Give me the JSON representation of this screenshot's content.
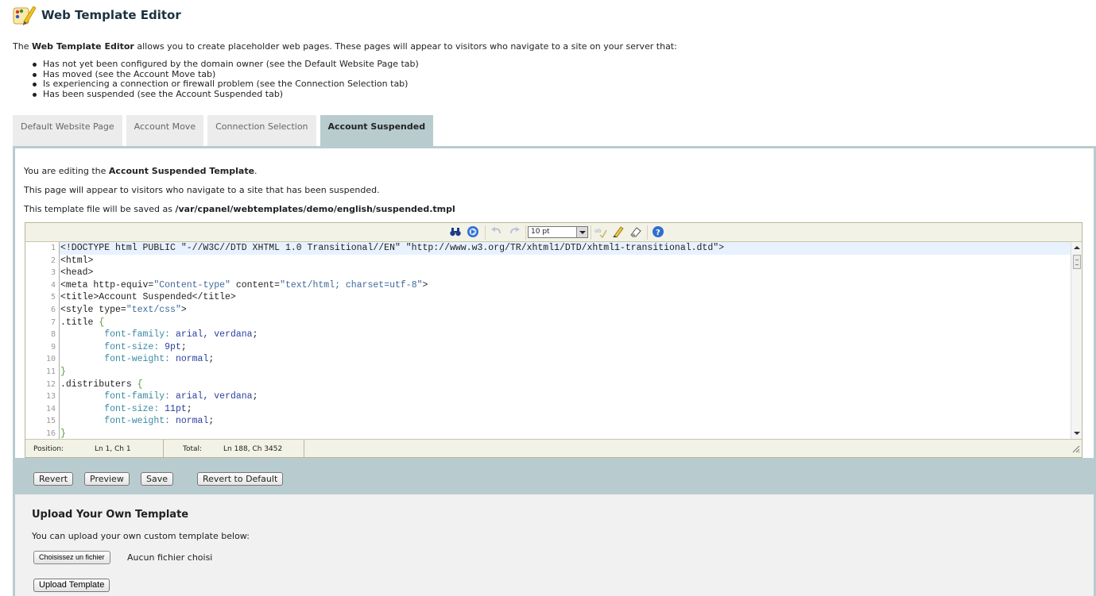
{
  "app": {
    "title": "Web Template Editor",
    "icon": "palette-brush-icon"
  },
  "intro": {
    "prefix": "The ",
    "bold": "Web Template Editor",
    "suffix": " allows you to create placeholder web pages. These pages will appear to visitors who navigate to a site on your server that:"
  },
  "bullets": [
    "Has not yet been configured by the domain owner (see the Default Website Page tab)",
    "Has moved (see the Account Move tab)",
    "Is experiencing a connection or firewall problem (see the Connection Selection tab)",
    "Has been suspended (see the Account Suspended tab)"
  ],
  "tabs": [
    {
      "label": "Default Website Page",
      "active": false
    },
    {
      "label": "Account Move",
      "active": false
    },
    {
      "label": "Connection Selection",
      "active": false
    },
    {
      "label": "Account Suspended",
      "active": true
    }
  ],
  "panel": {
    "editing_prefix": "You are editing the ",
    "editing_bold": "Account Suspended Template",
    "editing_suffix": ".",
    "description": "This page will appear to visitors who navigate to a site that has been suspended.",
    "path_prefix": "This template file will be saved as ",
    "path": "/var/cpanel/webtemplates/demo/english/suspended.tmpl"
  },
  "toolbar": {
    "font_size": "10 pt",
    "icons": [
      "search-icon",
      "goto-icon",
      "undo-icon",
      "redo-icon",
      "spellcheck-icon",
      "highlight-icon",
      "reset-icon",
      "help-icon"
    ]
  },
  "code": {
    "line_numbers": [
      "1",
      "2",
      "3",
      "4",
      "5",
      "6",
      "7",
      "8",
      "9",
      "10",
      "11",
      "12",
      "13",
      "14",
      "15",
      "16"
    ],
    "lines": [
      "<!DOCTYPE html PUBLIC \"-//W3C//DTD XHTML 1.0 Transitional//EN\" \"http://www.w3.org/TR/xhtml1/DTD/xhtml1-transitional.dtd\">",
      "<html>",
      "<head>",
      "<meta http-equiv=\"Content-type\" content=\"text/html; charset=utf-8\">",
      "<title>Account Suspended</title>",
      "<style type=\"text/css\">",
      ".title {",
      "        font-family: arial, verdana;",
      "        font-size: 9pt;",
      "        font-weight: normal;",
      "}",
      ".distributers {",
      "        font-family: arial, verdana;",
      "        font-size: 11pt;",
      "        font-weight: normal;",
      "}"
    ]
  },
  "statusbar": {
    "position_label": "Position:",
    "position_value": "Ln 1, Ch 1",
    "total_label": "Total:",
    "total_value": "Ln 188, Ch 3452"
  },
  "buttons": {
    "revert": "Revert",
    "preview": "Preview",
    "save": "Save",
    "revert_default": "Revert to Default"
  },
  "upload": {
    "title": "Upload Your Own Template",
    "description": "You can upload your own custom template below:",
    "file_button": "Choisissez un fichier",
    "file_status": "Aucun fichier choisi",
    "upload_button": "Upload Template"
  },
  "colors": {
    "accent": "#b8cccf",
    "title": "#1a3340",
    "toolbar_bg": "#f3f2e6"
  }
}
